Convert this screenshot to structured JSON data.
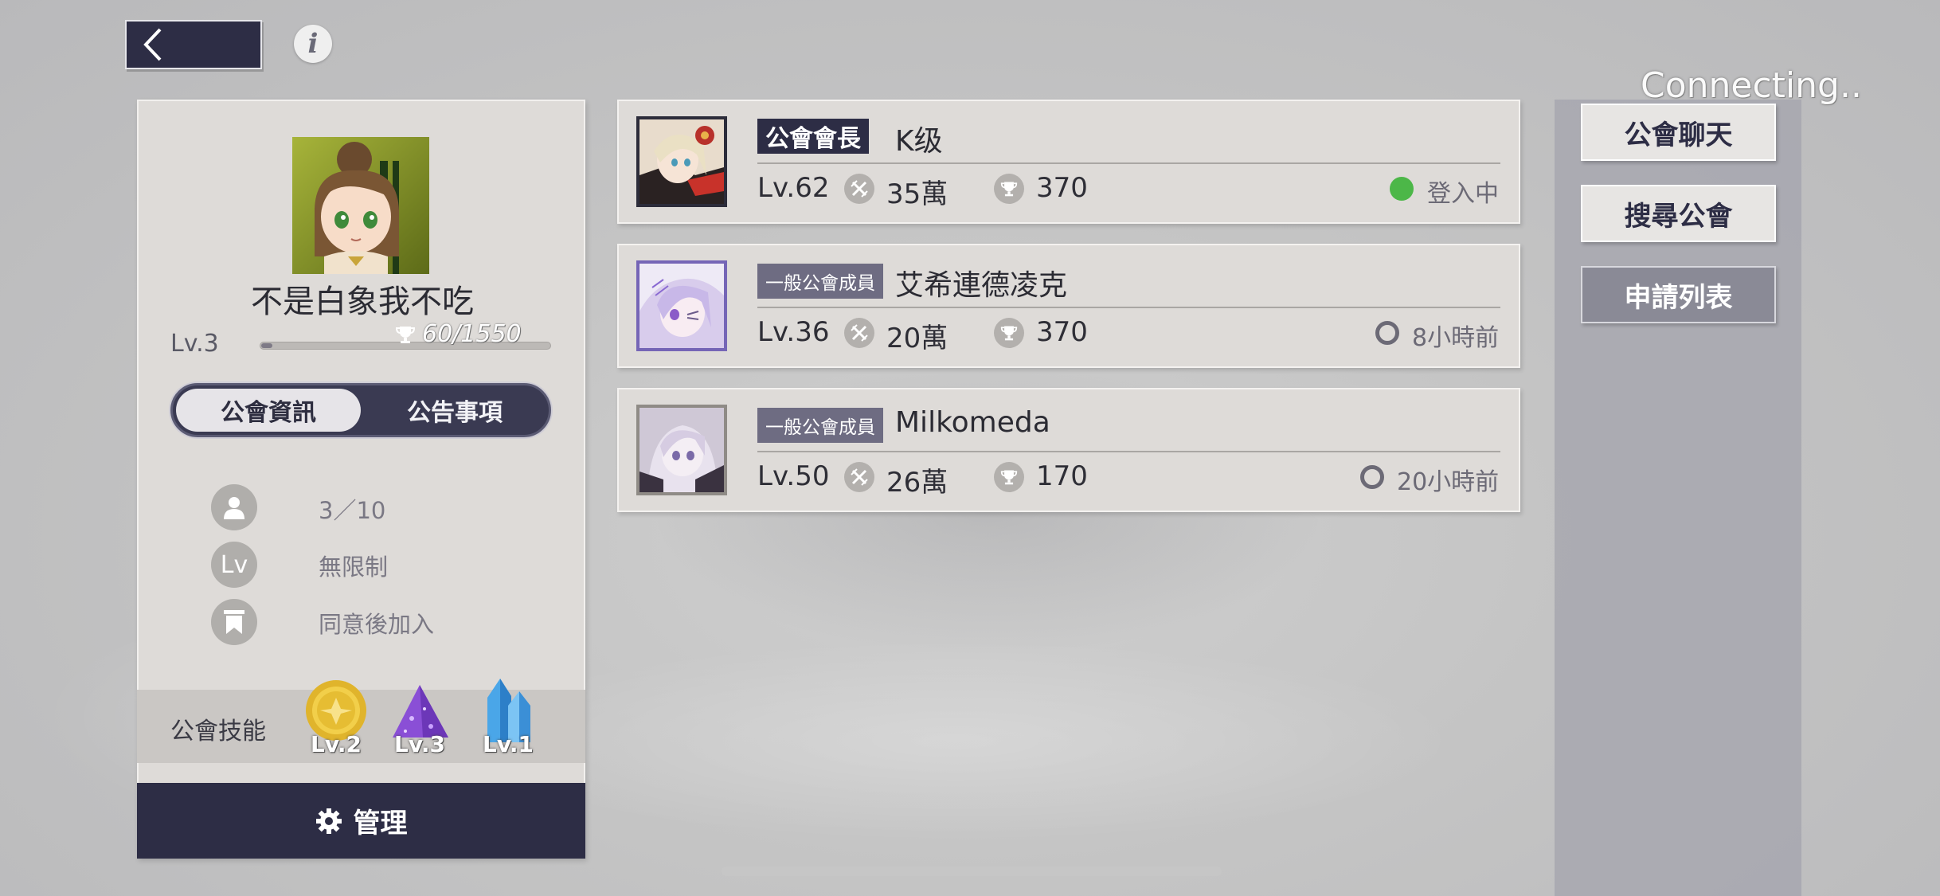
{
  "connection_status": "Connecting..",
  "nav": {
    "back_icon": "chevron-left-icon",
    "info_icon": "info-icon",
    "info_glyph": "i"
  },
  "guild": {
    "name": "不是白象我不吃",
    "level": "Lv.3",
    "exp_text": "60/1550",
    "exp_fraction": 0.039,
    "tabs": [
      {
        "label": "公會資訊",
        "active": true
      },
      {
        "label": "公告事項",
        "active": false
      }
    ],
    "info": [
      {
        "icon": "member-count-icon",
        "value": "3／10"
      },
      {
        "icon": "level-requirement-icon",
        "icon_text": "Lv",
        "value": "無限制"
      },
      {
        "icon": "join-policy-icon",
        "value": "同意後加入"
      }
    ],
    "skills_label": "公會技能",
    "skills": [
      {
        "icon": "gold-medal-icon",
        "level": "Lv.2"
      },
      {
        "icon": "purple-crystal-pile-icon",
        "level": "Lv.3"
      },
      {
        "icon": "blue-crystal-icon",
        "level": "Lv.1"
      }
    ],
    "manage_label": "管理"
  },
  "members": [
    {
      "rank": "公會會長",
      "name": "K级",
      "level": "Lv.62",
      "power": "35萬",
      "trophies": "370",
      "status": "登入中",
      "online": true
    },
    {
      "rank": "一般公會成員",
      "name": "艾希連德凌克",
      "level": "Lv.36",
      "power": "20萬",
      "trophies": "370",
      "status": "8小時前",
      "online": false
    },
    {
      "rank": "一般公會成員",
      "name": "Milkomeda",
      "level": "Lv.50",
      "power": "26萬",
      "trophies": "170",
      "status": "20小時前",
      "online": false
    }
  ],
  "side_buttons": [
    {
      "label": "公會聊天",
      "style": "light"
    },
    {
      "label": "搜尋公會",
      "style": "light"
    },
    {
      "label": "申請列表",
      "style": "dark"
    }
  ],
  "colors": {
    "accent_navy": "#2d2d45",
    "online_green": "#4cb748",
    "panel": "#dedbd8",
    "member_badge": "#6e6c82"
  }
}
